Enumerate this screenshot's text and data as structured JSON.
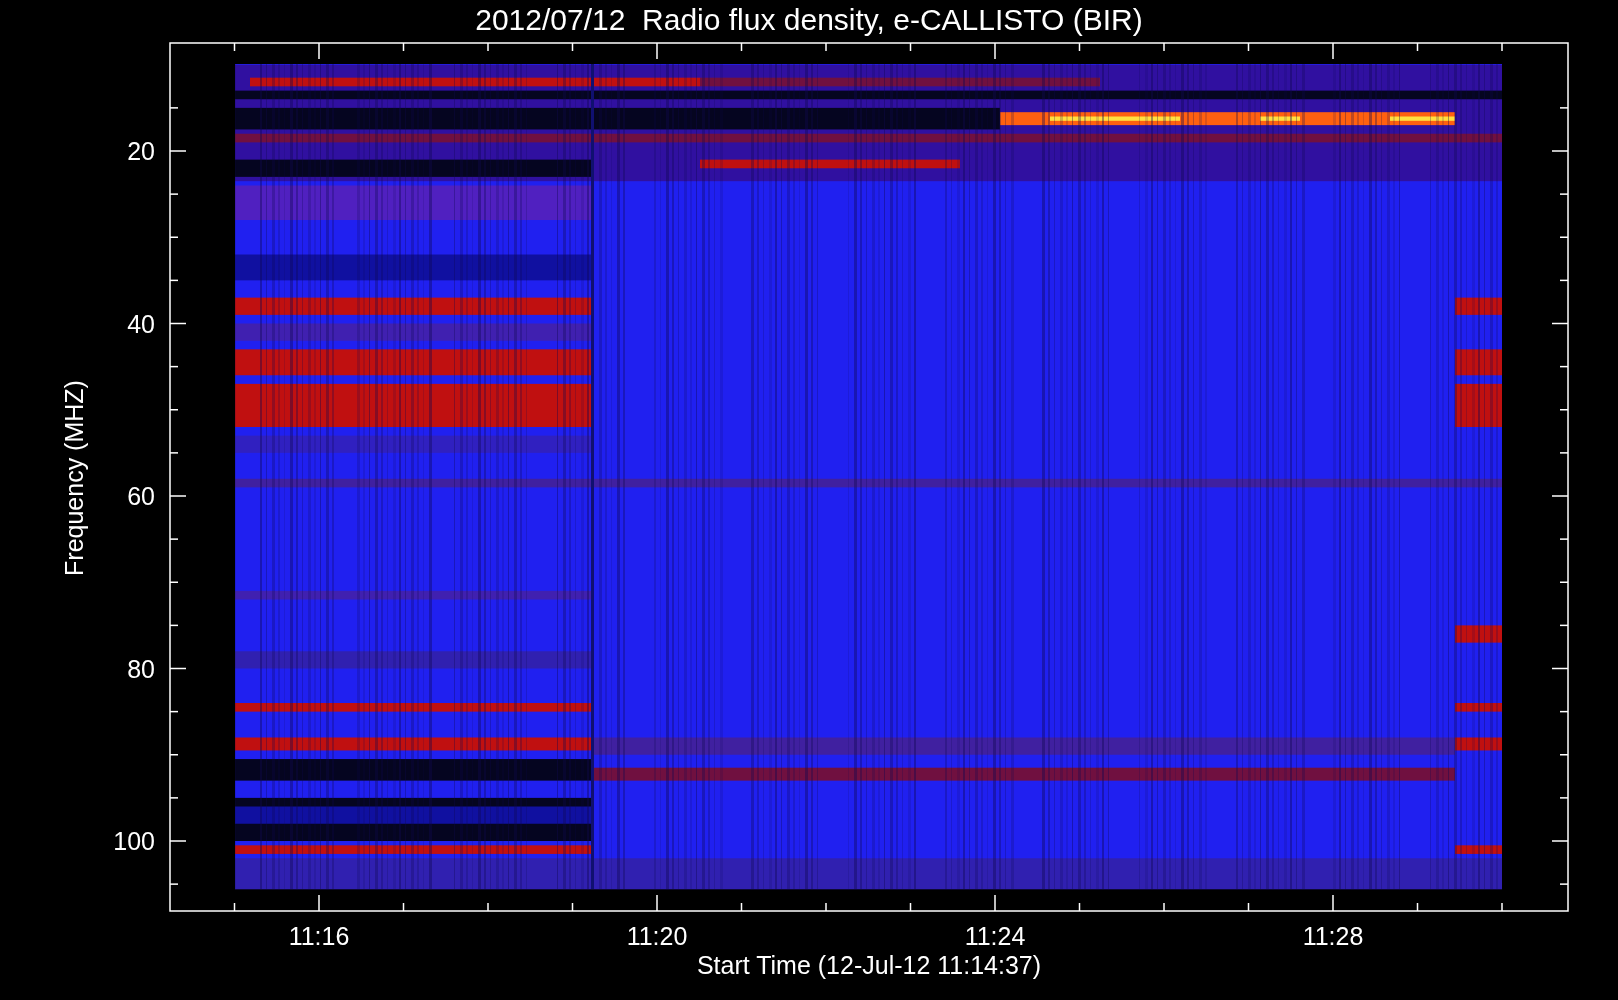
{
  "title": "2012/07/12  Radio flux density, e-CALLISTO (BIR)",
  "plot": {
    "ylabel": "Frequency (MHZ)",
    "xlabel": "Start Time (12-Jul-12 11:14:37)",
    "yticks": [
      "20",
      "40",
      "60",
      "80",
      "100"
    ],
    "xticks": [
      "11:16",
      "11:20",
      "11:24",
      "11:28"
    ]
  }
}
